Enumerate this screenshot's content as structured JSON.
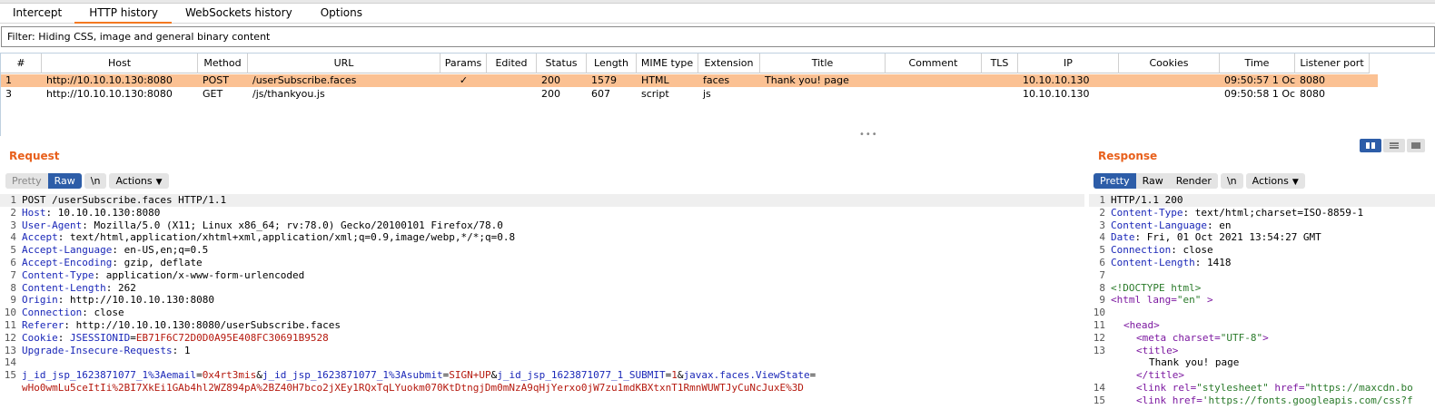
{
  "tabs": [
    {
      "label": "Intercept"
    },
    {
      "label": "HTTP history",
      "active": true
    },
    {
      "label": "WebSockets history"
    },
    {
      "label": "Options"
    }
  ],
  "filter_text": "Filter: Hiding CSS, image and general binary content",
  "history_table": {
    "columns": [
      "#",
      "Host",
      "Method",
      "URL",
      "Params",
      "Edited",
      "Status",
      "Length",
      "MIME type",
      "Extension",
      "Title",
      "Comment",
      "TLS",
      "IP",
      "Cookies",
      "Time",
      "Listener port"
    ],
    "rows": [
      {
        "num": "1",
        "host": "http://10.10.10.130:8080",
        "method": "POST",
        "url": "/userSubscribe.faces",
        "params": "✓",
        "edited": "",
        "status": "200",
        "length": "1579",
        "mime": "HTML",
        "ext": "faces",
        "title": "Thank you! page",
        "comment": "",
        "tls": "",
        "ip": "10.10.10.130",
        "cookies": "",
        "time": "09:50:57 1 Oc...",
        "port": "8080",
        "selected": true
      },
      {
        "num": "3",
        "host": "http://10.10.10.130:8080",
        "method": "GET",
        "url": "/js/thankyou.js",
        "params": "",
        "edited": "",
        "status": "200",
        "length": "607",
        "mime": "script",
        "ext": "js",
        "title": "",
        "comment": "",
        "tls": "",
        "ip": "10.10.10.130",
        "cookies": "",
        "time": "09:50:58 1 Oc...",
        "port": "8080",
        "selected": false
      }
    ]
  },
  "splitter_handle": "•••",
  "request": {
    "title": "Request",
    "buttons": {
      "pretty": "Pretty",
      "raw": "Raw",
      "newline": "\\n",
      "actions": "Actions"
    },
    "lines": [
      {
        "n": "1",
        "key": "",
        "val": "POST /userSubscribe.faces HTTP/1.1"
      },
      {
        "n": "2",
        "key": "Host",
        "val": " 10.10.10.130:8080"
      },
      {
        "n": "3",
        "key": "User-Agent",
        "val": " Mozilla/5.0 (X11; Linux x86_64; rv:78.0) Gecko/20100101 Firefox/78.0"
      },
      {
        "n": "4",
        "key": "Accept",
        "val": " text/html,application/xhtml+xml,application/xml;q=0.9,image/webp,*/*;q=0.8"
      },
      {
        "n": "5",
        "key": "Accept-Language",
        "val": " en-US,en;q=0.5"
      },
      {
        "n": "6",
        "key": "Accept-Encoding",
        "val": " gzip, deflate"
      },
      {
        "n": "7",
        "key": "Content-Type",
        "val": " application/x-www-form-urlencoded"
      },
      {
        "n": "8",
        "key": "Content-Length",
        "val": " 262"
      },
      {
        "n": "9",
        "key": "Origin",
        "val": " http://10.10.10.130:8080"
      },
      {
        "n": "10",
        "key": "Connection",
        "val": " close"
      },
      {
        "n": "11",
        "key": "Referer",
        "val": " http://10.10.10.130:8080/userSubscribe.faces"
      },
      {
        "n": "12",
        "key": "Cookie",
        "val": "",
        "cookie_name": "JSESSIONID",
        "cookie_value": "EB71F6C72D0D0A95E408FC30691B9528"
      },
      {
        "n": "13",
        "key": "Upgrade-Insecure-Requests",
        "val": " 1"
      },
      {
        "n": "14",
        "key": "",
        "val": ""
      },
      {
        "n": "15",
        "key": "",
        "val": ""
      }
    ],
    "body_params": [
      {
        "name": "j_id_jsp_1623871077_1%3Aemail",
        "value": "0x4rt3mis"
      },
      {
        "name": "j_id_jsp_1623871077_1%3Asubmit",
        "value": "SIGN+UP"
      },
      {
        "name": "j_id_jsp_1623871077_1_SUBMIT",
        "value": "1"
      },
      {
        "name": "javax.faces.ViewState",
        "value": ""
      }
    ],
    "body_line2": "wHo0wmLu5ceItIi%2BI7XkEi1GAb4hl2WZ894pA%2BZ40H7bco2jXEy1RQxTqLYuokm070KtDtngjDm0mNzA9qHjYerxo0jW7zu1mdKBXtxnT1RmnWUWTJyCuNcJuxE%3D"
  },
  "response": {
    "title": "Response",
    "buttons": {
      "pretty": "Pretty",
      "raw": "Raw",
      "render": "Render",
      "newline": "\\n",
      "actions": "Actions"
    },
    "lines": [
      {
        "n": "1",
        "text": "HTTP/1.1 200"
      },
      {
        "n": "2",
        "key": "Content-Type",
        "val": " text/html;charset=ISO-8859-1"
      },
      {
        "n": "3",
        "key": "Content-Language",
        "val": " en"
      },
      {
        "n": "4",
        "key": "Date",
        "val": " Fri, 01 Oct 2021 13:54:27 GMT"
      },
      {
        "n": "5",
        "key": "Connection",
        "val": " close"
      },
      {
        "n": "6",
        "key": "Content-Length",
        "val": " 1418"
      },
      {
        "n": "7",
        "text": ""
      },
      {
        "n": "8",
        "text": "<!DOCTYPE html>"
      },
      {
        "n": "9",
        "text": ""
      },
      {
        "n": "10",
        "text": ""
      },
      {
        "n": "11",
        "text": ""
      },
      {
        "n": "12",
        "text": ""
      },
      {
        "n": "13",
        "text": ""
      },
      {
        "n": "",
        "text": ""
      },
      {
        "n": "",
        "text": ""
      },
      {
        "n": "14",
        "text": ""
      },
      {
        "n": "15",
        "text": ""
      }
    ],
    "html_tokens": {
      "html_open": "<html",
      "lang_attr": " lang=",
      "lang_val": "\"en\"",
      "html_close": " >",
      "head": "<head>",
      "meta_open": "<meta",
      "charset_attr": " charset=",
      "charset_val": "\"UTF-8\"",
      "meta_close": ">",
      "title_open": "<title>",
      "title_text": "Thank you! page",
      "title_close": "</title>",
      "link1_open": "<link",
      "link1_rel": " rel=",
      "link1_rel_val": "\"stylesheet\"",
      "link1_href": " href=",
      "link1_href_val": "\"https://maxcdn.bo",
      "link2_open": "<link",
      "link2_href": " href=",
      "link2_href_val": "'https://fonts.googleapis.com/css?f"
    }
  },
  "colors": {
    "accent": "#f47920",
    "selected_row": "#fbc193",
    "button_active": "#2d5da8",
    "header_key": "#1a27b8",
    "cookie_value": "#b5190e",
    "html_attr_value": "#2a7a2a"
  }
}
